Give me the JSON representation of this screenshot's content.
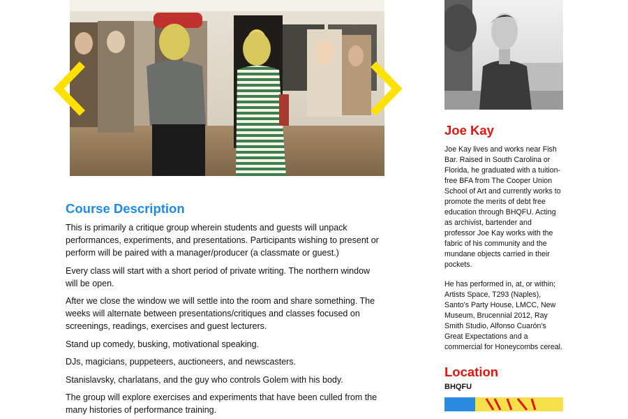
{
  "slideshow": {
    "prev_icon": "chevron-left-icon",
    "next_icon": "chevron-right-icon",
    "arrow_color": "#ffe100"
  },
  "course": {
    "title": "Course Description",
    "title_color": "#1e8ae6",
    "paragraphs": [
      "This is primarily a critique group wherein students and guests will unpack performances, experiments, and presentations. Participants wishing to present or perform will be paired with a manager/producer (a classmate or guest.)",
      "Every class will start with a short period of private writing. The northern window will be open.",
      "After we close the window we will settle into the room and share something. The weeks will alternate between presentations/critiques and classes focused on screenings, readings, exercises and guest lecturers.",
      "Stand up comedy, busking, motivational speaking.",
      "DJs, magicians, puppeteers, auctioneers,  and newscasters.",
      "Stanislavsky, charlatans, and the guy who controls Golem with his body.",
      "The group will explore exercises and experiments that have been culled from the many histories of performance training."
    ]
  },
  "instructor": {
    "name": "Joe Kay",
    "name_color": "#e1140f",
    "bio": [
      "Joe Kay lives and works near Fish Bar. Raised in South Carolina or Florida, he graduated with a tuition-free BFA from The Cooper Union School of Art and currently works to promote the merits of debt free education through BHQFU. Acting as archivist, bartender and professor Joe Kay works with the fabric of his community and the mundane objects carried in their pockets.",
      "He has performed in, at, or within; Artists Space, T293 (Naples), Santo's Party House, LMCC, New Museum, Brucennial 2012, Ray Smith Studio, Alfonso Cuarón's Great Expectations and a commercial for Honeycombs cereal."
    ]
  },
  "location": {
    "title": "Location",
    "name": "BHQFU"
  }
}
